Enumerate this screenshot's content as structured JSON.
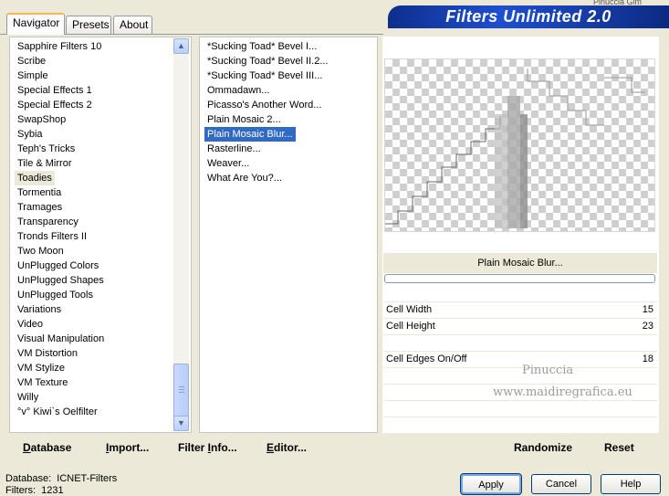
{
  "tabs": [
    "Navigator",
    "Presets",
    "About"
  ],
  "banner_title": "Filters Unlimited 2.0",
  "topright_text": "Pinuccia  Gim",
  "categories": [
    "Sapphire Filters 10",
    "Scribe",
    "Simple",
    "Special Effects 1",
    "Special Effects 2",
    "SwapShop",
    "Sybia",
    "Teph's Tricks",
    "Tile & Mirror",
    "Toadies",
    "Tormentia",
    "Tramages",
    "Transparency",
    "Tronds Filters II",
    "Two Moon",
    "UnPlugged Colors",
    "UnPlugged Shapes",
    "UnPlugged Tools",
    "Variations",
    "Video",
    "Visual Manipulation",
    "VM Distortion",
    "VM Stylize",
    "VM Texture",
    "Willy",
    "°v° Kiwi`s Oelfilter"
  ],
  "selected_category": "Toadies",
  "filters": [
    "*Sucking Toad*  Bevel I...",
    "*Sucking Toad*  Bevel II.2...",
    "*Sucking Toad*  Bevel III...",
    "Ommadawn...",
    "Picasso's Another Word...",
    "Plain Mosaic 2...",
    "Plain Mosaic Blur...",
    "Rasterline...",
    "Weaver...",
    "What Are You?..."
  ],
  "selected_filter": "Plain Mosaic Blur...",
  "filter_name": "Plain Mosaic Blur...",
  "params": [
    {
      "label": "Cell Width",
      "value": "15"
    },
    {
      "label": "Cell Height",
      "value": "23"
    },
    {
      "label": "Cell Edges On/Off",
      "value": "18"
    }
  ],
  "watermark": {
    "line1": "Pinuccia",
    "line2": "www.maidiregrafica.eu"
  },
  "toolbar": {
    "database": {
      "u": "D",
      "rest": "atabase"
    },
    "import": {
      "u": "I",
      "rest": "mport..."
    },
    "filter_info": {
      "pre": "Filter ",
      "u": "I",
      "rest": "nfo..."
    },
    "editor": {
      "u": "E",
      "rest": "ditor..."
    },
    "randomize": "Randomize",
    "reset": "Reset"
  },
  "status": {
    "database_label": "Database:",
    "database_value": "ICNET-Filters",
    "filters_label": "Filters:",
    "filters_value": "1231"
  },
  "buttons": {
    "apply": "Apply",
    "cancel": "Cancel",
    "help": "Help"
  },
  "icons": {
    "scroll_up": "chevron-up-icon",
    "scroll_down": "chevron-down-icon"
  }
}
